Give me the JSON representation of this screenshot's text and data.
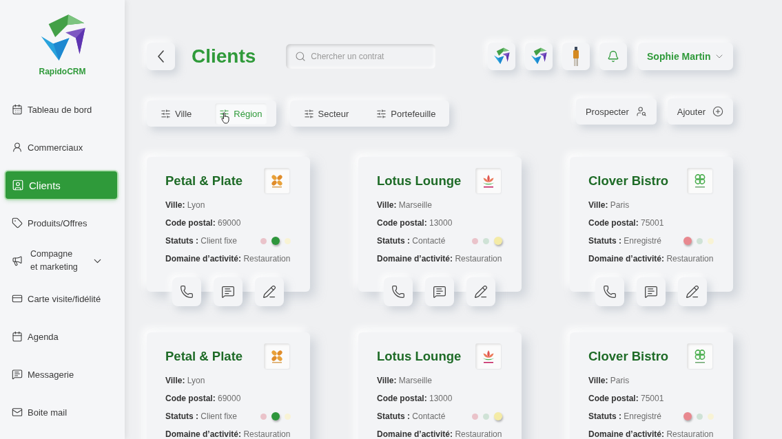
{
  "sidebar": {
    "brand": "RapidoCRM",
    "items": [
      {
        "label": "Tableau de bord",
        "kind": "link",
        "selected": false
      },
      {
        "label": "Commerciaux",
        "kind": "link",
        "selected": false
      },
      {
        "label": "Clients",
        "kind": "link",
        "selected": true
      },
      {
        "label": "Produits/Offres",
        "kind": "link",
        "selected": false
      },
      {
        "label": "Compagne et marketing",
        "kind": "group",
        "selected": false,
        "expanded": false
      },
      {
        "label": "Carte visite/fidélité",
        "kind": "link",
        "selected": false
      },
      {
        "label": "Agenda",
        "kind": "link",
        "selected": false
      },
      {
        "label": "Messagerie",
        "kind": "link",
        "selected": false
      },
      {
        "label": "Boite mail",
        "kind": "link",
        "selected": false
      }
    ]
  },
  "header": {
    "title": "Clients",
    "search": {
      "placeholder": "Chercher un contrat"
    },
    "user": {
      "name": "Sophie Martin",
      "expanded": false
    }
  },
  "filters": {
    "groups": [
      {
        "items": [
          {
            "label": "Ville",
            "selected": false
          },
          {
            "label": "Région",
            "selected": true
          }
        ]
      },
      {
        "items": [
          {
            "label": "Secteur",
            "selected": false
          },
          {
            "label": "Portefeuille",
            "selected": false
          }
        ]
      }
    ],
    "actions": [
      {
        "label": "Prospecter",
        "kind": "prospect"
      },
      {
        "label": "Ajouter",
        "kind": "add"
      }
    ]
  },
  "cards": [
    {
      "name": "Petal & Plate",
      "logo": {
        "kind": "flower"
      },
      "fields": [
        {
          "kind": "text",
          "label": "Ville:",
          "value": "Lyon"
        },
        {
          "kind": "text",
          "label": "Code postal:",
          "value": "69000"
        },
        {
          "kind": "status",
          "label": "Statuts :",
          "value": "Client fixe",
          "dots": [
            {
              "color": "#eac3ca",
              "selected": false
            },
            {
              "color": "#2e963c",
              "selected": true
            },
            {
              "color": "#f8f3d5",
              "selected": false
            }
          ]
        },
        {
          "kind": "text",
          "label": "Domaine d’activité:",
          "value": "Restauration"
        }
      ],
      "actions": [
        {
          "kind": "call"
        },
        {
          "kind": "message"
        },
        {
          "kind": "edit"
        }
      ]
    },
    {
      "name": "Lotus Lounge",
      "logo": {
        "kind": "lotus"
      },
      "fields": [
        {
          "kind": "text",
          "label": "Ville:",
          "value": "Marseille"
        },
        {
          "kind": "text",
          "label": "Code postal:",
          "value": "13000"
        },
        {
          "kind": "status",
          "label": "Statuts :",
          "value": "Contacté",
          "dots": [
            {
              "color": "#eac3ca",
              "selected": false
            },
            {
              "color": "#cfe2d6",
              "selected": false
            },
            {
              "color": "#f4eba6",
              "selected": true
            }
          ]
        },
        {
          "kind": "text",
          "label": "Domaine d’activité:",
          "value": "Restauration"
        }
      ],
      "actions": [
        {
          "kind": "call"
        },
        {
          "kind": "message"
        },
        {
          "kind": "edit"
        }
      ]
    },
    {
      "name": "Clover Bistro",
      "logo": {
        "kind": "clover"
      },
      "fields": [
        {
          "kind": "text",
          "label": "Ville:",
          "value": "Paris"
        },
        {
          "kind": "text",
          "label": "Code postal:",
          "value": "75001"
        },
        {
          "kind": "status",
          "label": "Statuts :",
          "value": "Enregistré",
          "dots": [
            {
              "color": "#e8888f",
              "selected": true
            },
            {
              "color": "#cfe2d6",
              "selected": false
            },
            {
              "color": "#f8f3d5",
              "selected": false
            }
          ]
        },
        {
          "kind": "text",
          "label": "Domaine d’activité:",
          "value": "Restauration"
        }
      ],
      "actions": [
        {
          "kind": "call"
        },
        {
          "kind": "message"
        },
        {
          "kind": "edit"
        }
      ]
    },
    {
      "name": "Petal & Plate",
      "logo": {
        "kind": "flower"
      },
      "fields": [
        {
          "kind": "text",
          "label": "Ville:",
          "value": "Lyon"
        },
        {
          "kind": "text",
          "label": "Code postal:",
          "value": "69000"
        },
        {
          "kind": "status",
          "label": "Statuts :",
          "value": "Client fixe",
          "dots": [
            {
              "color": "#eac3ca",
              "selected": false
            },
            {
              "color": "#2e963c",
              "selected": true
            },
            {
              "color": "#f8f3d5",
              "selected": false
            }
          ]
        },
        {
          "kind": "text",
          "label": "Domaine d’activité:",
          "value": "Restauration"
        }
      ]
    },
    {
      "name": "Lotus Lounge",
      "logo": {
        "kind": "lotus"
      },
      "fields": [
        {
          "kind": "text",
          "label": "Ville:",
          "value": "Marseille"
        },
        {
          "kind": "text",
          "label": "Code postal:",
          "value": "13000"
        },
        {
          "kind": "status",
          "label": "Statuts :",
          "value": "Contacté",
          "dots": [
            {
              "color": "#eac3ca",
              "selected": false
            },
            {
              "color": "#cfe2d6",
              "selected": false
            },
            {
              "color": "#f4eba6",
              "selected": true
            }
          ]
        },
        {
          "kind": "text",
          "label": "Domaine d’activité:",
          "value": "Restauration"
        }
      ]
    },
    {
      "name": "Clover Bistro",
      "logo": {
        "kind": "clover"
      },
      "fields": [
        {
          "kind": "text",
          "label": "Ville:",
          "value": "Paris"
        },
        {
          "kind": "text",
          "label": "Code postal:",
          "value": "75001"
        },
        {
          "kind": "status",
          "label": "Statuts :",
          "value": "Enregistré",
          "dots": [
            {
              "color": "#e8888f",
              "selected": true
            },
            {
              "color": "#cfe2d6",
              "selected": false
            },
            {
              "color": "#f8f3d5",
              "selected": false
            }
          ]
        },
        {
          "kind": "text",
          "label": "Domaine d’activité:",
          "value": "Restauration"
        }
      ]
    }
  ]
}
